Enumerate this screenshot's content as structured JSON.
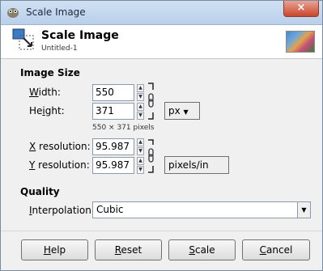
{
  "window": {
    "title": "Scale Image",
    "close_glyph": "×"
  },
  "header": {
    "title": "Scale Image",
    "subtitle": "Untitled-1"
  },
  "image_size": {
    "section_label": "Image Size",
    "width": {
      "label": "Width:",
      "label_prefix": "",
      "label_ul": "W",
      "label_rest": "idth:",
      "value": "550"
    },
    "height": {
      "label": "Height:",
      "label_prefix": "He",
      "label_ul": "i",
      "label_rest": "ght:",
      "value": "371"
    },
    "unit": "px",
    "dimensions_text": "550 × 371 pixels",
    "x_res": {
      "label": "X resolution:",
      "label_ul": "X",
      "label_rest": " resolution:",
      "value": "95.987"
    },
    "y_res": {
      "label": "Y resolution:",
      "label_ul": "Y",
      "label_rest": " resolution:",
      "value": "95.987"
    },
    "res_unit": "pixels/in"
  },
  "quality": {
    "section_label": "Quality",
    "interpolation_label": "Interpolation:",
    "interpolation_ul": "I",
    "interpolation_rest": "nterpolation:",
    "interpolation_value": "Cubic"
  },
  "buttons": {
    "help": {
      "ul": "H",
      "rest": "elp"
    },
    "reset": {
      "ul": "R",
      "rest": "eset"
    },
    "scale": {
      "ul": "S",
      "rest": "cale"
    },
    "cancel": {
      "ul": "C",
      "rest": "ancel"
    }
  },
  "colors": {
    "titlebar": "#c4d8ee",
    "close": "#c9462c",
    "panel": "#f0f0f0"
  }
}
